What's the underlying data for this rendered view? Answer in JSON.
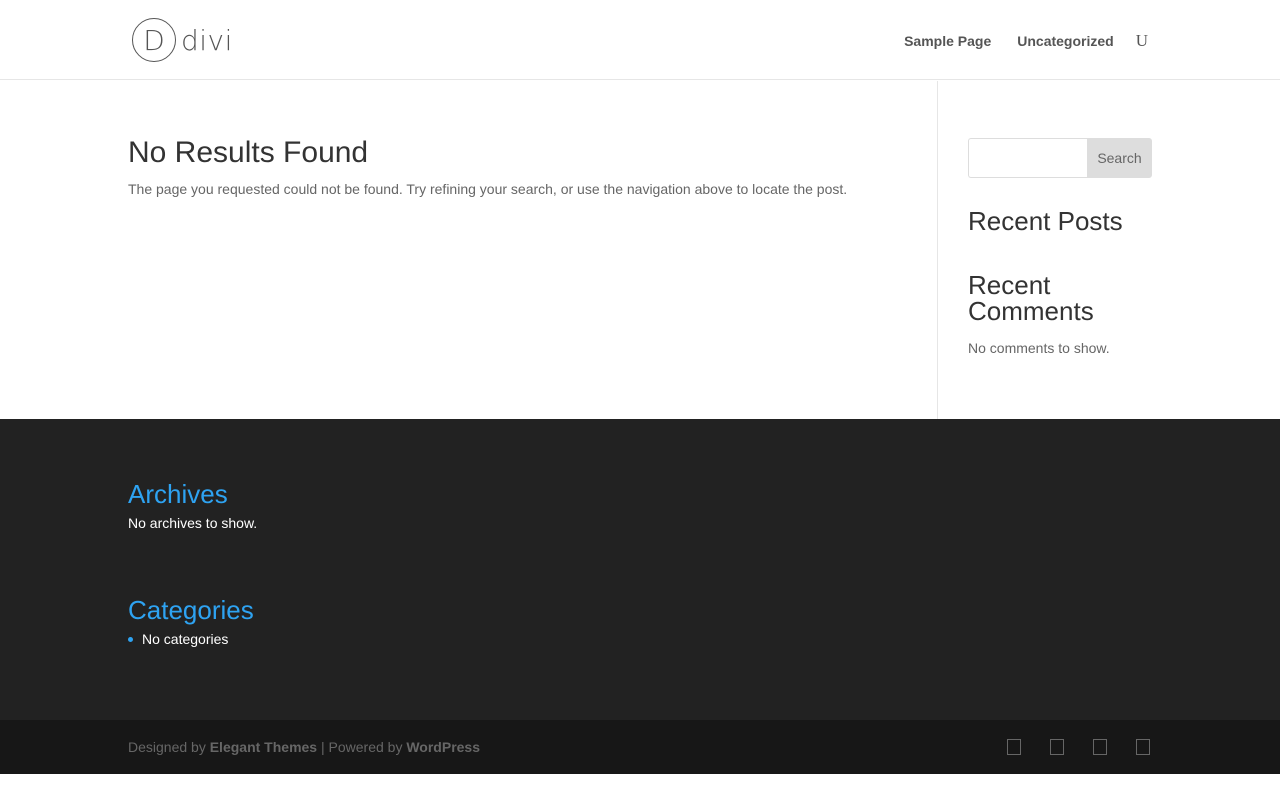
{
  "header": {
    "logo_letter": "D",
    "logo_text": "divi",
    "nav": [
      {
        "label": "Sample Page"
      },
      {
        "label": "Uncategorized"
      }
    ],
    "search_glyph": "U"
  },
  "main": {
    "title": "No Results Found",
    "message": "The page you requested could not be found. Try refining your search, or use the navigation above to locate the post."
  },
  "sidebar": {
    "search_button_label": "Search",
    "search_placeholder": "",
    "recent_posts_title": "Recent Posts",
    "recent_comments_title": "Recent Comments",
    "no_comments_text": "No comments to show."
  },
  "footer": {
    "archives_title": "Archives",
    "archives_text": "No archives to show.",
    "categories_title": "Categories",
    "categories_items": [
      "No categories"
    ],
    "credits_prefix": "Designed by",
    "credits_designer": "Elegant Themes",
    "credits_middle": "| Powered by",
    "credits_platform": "WordPress",
    "accent_color": "#2ea3f2",
    "social_icons": [
      "facebook-icon",
      "twitter-icon",
      "google-plus-icon",
      "rss-icon"
    ]
  }
}
